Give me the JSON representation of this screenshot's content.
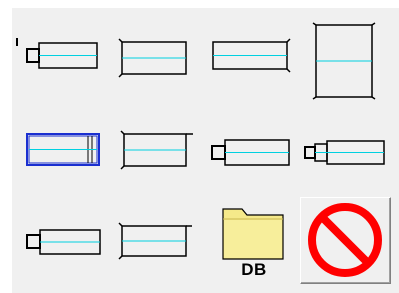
{
  "toolbox": {
    "items": [
      {
        "id": "shape-1",
        "kind": "stepped-short-long"
      },
      {
        "id": "shape-2",
        "kind": "flanged-cylinder"
      },
      {
        "id": "shape-3",
        "kind": "plain-long"
      },
      {
        "id": "shape-4",
        "kind": "tall-square-bulged"
      },
      {
        "id": "shape-5",
        "kind": "blue-selected-cylinder"
      },
      {
        "id": "shape-6",
        "kind": "flanged-cylinder-2"
      },
      {
        "id": "shape-7",
        "kind": "stepped-2"
      },
      {
        "id": "shape-8",
        "kind": "stepped-small"
      },
      {
        "id": "shape-9",
        "kind": "stepped-3"
      },
      {
        "id": "shape-10",
        "kind": "flanged-cylinder-3"
      }
    ],
    "database_button": {
      "label": "DB"
    },
    "disable_button": {
      "icon": "no-entry-icon"
    }
  },
  "colors": {
    "outline": "#000000",
    "axis": "#00d0e0",
    "selected": "#1a2fd0",
    "prohibit": "#ff0000",
    "folder": "#f5e98a"
  }
}
